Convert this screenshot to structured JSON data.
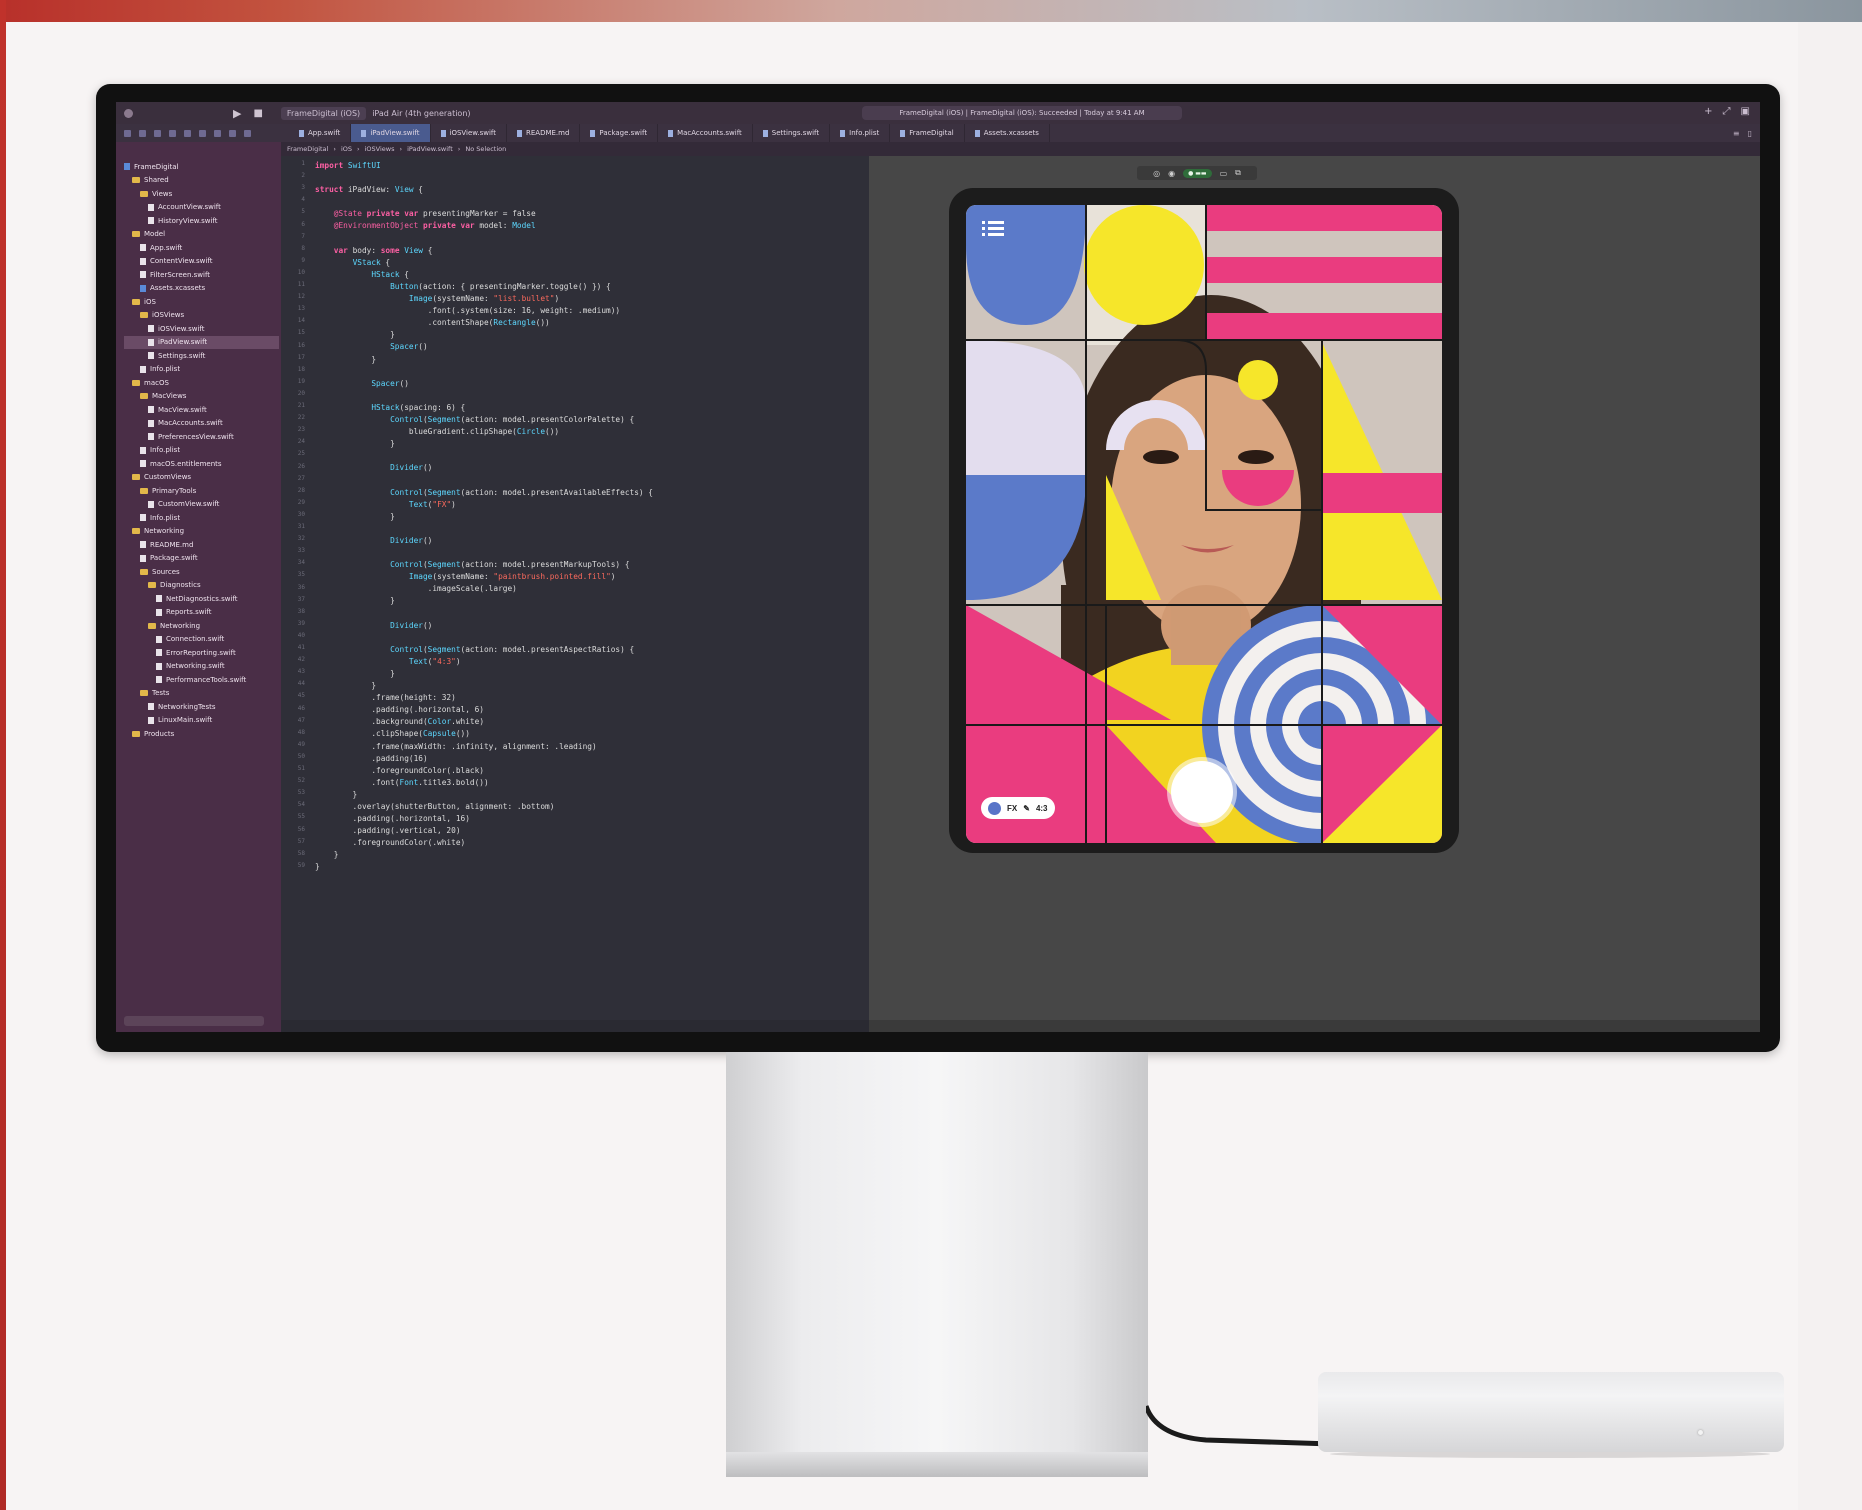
{
  "xcode": {
    "scheme": [
      "FrameDigital (iOS)",
      "iPad Air (4th generation)"
    ],
    "status": "FrameDigital (iOS) | FrameDigital (iOS): Succeeded | Today at 9:41 AM",
    "tabs": [
      "App.swift",
      "iPadView.swift",
      "iOSView.swift",
      "README.md",
      "Package.swift",
      "MacAccounts.swift",
      "Settings.swift",
      "Info.plist",
      "FrameDigital",
      "Assets.xcassets"
    ],
    "active_tab_index": 1,
    "jump_path": [
      "FrameDigital",
      "iOS",
      "iOSViews",
      "iPadView.swift",
      "No Selection"
    ],
    "navigator": [
      {
        "label": "FrameDigital",
        "kind": "proj",
        "indent": 0
      },
      {
        "label": "Shared",
        "kind": "folder",
        "indent": 1
      },
      {
        "label": "Views",
        "kind": "folder",
        "indent": 2
      },
      {
        "label": "AccountView.swift",
        "kind": "file",
        "indent": 3
      },
      {
        "label": "HistoryView.swift",
        "kind": "file",
        "indent": 3
      },
      {
        "label": "Model",
        "kind": "folder",
        "indent": 1
      },
      {
        "label": "App.swift",
        "kind": "file",
        "indent": 2
      },
      {
        "label": "ContentView.swift",
        "kind": "file",
        "indent": 2
      },
      {
        "label": "FilterScreen.swift",
        "kind": "file",
        "indent": 2
      },
      {
        "label": "Assets.xcassets",
        "kind": "proj",
        "indent": 2
      },
      {
        "label": "iOS",
        "kind": "folder",
        "indent": 1
      },
      {
        "label": "iOSViews",
        "kind": "folder",
        "indent": 2
      },
      {
        "label": "iOSView.swift",
        "kind": "file",
        "indent": 3
      },
      {
        "label": "iPadView.swift",
        "kind": "file",
        "indent": 3,
        "selected": true
      },
      {
        "label": "Settings.swift",
        "kind": "file",
        "indent": 3
      },
      {
        "label": "Info.plist",
        "kind": "file",
        "indent": 2
      },
      {
        "label": "macOS",
        "kind": "folder",
        "indent": 1
      },
      {
        "label": "MacViews",
        "kind": "folder",
        "indent": 2
      },
      {
        "label": "MacView.swift",
        "kind": "file",
        "indent": 3
      },
      {
        "label": "MacAccounts.swift",
        "kind": "file",
        "indent": 3
      },
      {
        "label": "PreferencesView.swift",
        "kind": "file",
        "indent": 3
      },
      {
        "label": "Info.plist",
        "kind": "file",
        "indent": 2
      },
      {
        "label": "macOS.entitlements",
        "kind": "file",
        "indent": 2
      },
      {
        "label": "CustomViews",
        "kind": "folder",
        "indent": 1
      },
      {
        "label": "PrimaryTools",
        "kind": "folder",
        "indent": 2
      },
      {
        "label": "CustomView.swift",
        "kind": "file",
        "indent": 3
      },
      {
        "label": "Info.plist",
        "kind": "file",
        "indent": 2
      },
      {
        "label": "Networking",
        "kind": "folder",
        "indent": 1
      },
      {
        "label": "README.md",
        "kind": "file",
        "indent": 2
      },
      {
        "label": "Package.swift",
        "kind": "file",
        "indent": 2
      },
      {
        "label": "Sources",
        "kind": "folder",
        "indent": 2
      },
      {
        "label": "Diagnostics",
        "kind": "folder",
        "indent": 3
      },
      {
        "label": "NetDiagnostics.swift",
        "kind": "file",
        "indent": 4
      },
      {
        "label": "Reports.swift",
        "kind": "file",
        "indent": 4
      },
      {
        "label": "Networking",
        "kind": "folder",
        "indent": 3
      },
      {
        "label": "Connection.swift",
        "kind": "file",
        "indent": 4
      },
      {
        "label": "ErrorReporting.swift",
        "kind": "file",
        "indent": 4
      },
      {
        "label": "Networking.swift",
        "kind": "file",
        "indent": 4
      },
      {
        "label": "PerformanceTools.swift",
        "kind": "file",
        "indent": 4
      },
      {
        "label": "Tests",
        "kind": "folder",
        "indent": 2
      },
      {
        "label": "NetworkingTests",
        "kind": "file",
        "indent": 3
      },
      {
        "label": "LinuxMain.swift",
        "kind": "file",
        "indent": 3
      },
      {
        "label": "Products",
        "kind": "folder",
        "indent": 1
      }
    ],
    "code_lines": [
      "import SwiftUI",
      "",
      "struct iPadView: View {",
      "",
      "    @State private var presentingMarker = false",
      "    @EnvironmentObject private var model: Model",
      "",
      "    var body: some View {",
      "        VStack {",
      "            HStack {",
      "                Button(action: { presentingMarker.toggle() }) {",
      "                    Image(systemName: \"list.bullet\")",
      "                        .font(.system(size: 16, weight: .medium))",
      "                        .contentShape(Rectangle())",
      "                }",
      "                Spacer()",
      "            }",
      "",
      "            Spacer()",
      "",
      "            HStack(spacing: 6) {",
      "                Control(Segment(action: model.presentColorPalette) {",
      "                    blueGradient.clipShape(Circle())",
      "                }",
      "",
      "                Divider()",
      "",
      "                Control(Segment(action: model.presentAvailableEffects) {",
      "                    Text(\"FX\")",
      "                }",
      "",
      "                Divider()",
      "",
      "                Control(Segment(action: model.presentMarkupTools) {",
      "                    Image(systemName: \"paintbrush.pointed.fill\")",
      "                        .imageScale(.large)",
      "                }",
      "",
      "                Divider()",
      "",
      "                Control(Segment(action: model.presentAspectRatios) {",
      "                    Text(\"4:3\")",
      "                }",
      "            }",
      "            .frame(height: 32)",
      "            .padding(.horizontal, 6)",
      "            .background(Color.white)",
      "            .clipShape(Capsule())",
      "            .frame(maxWidth: .infinity, alignment: .leading)",
      "            .padding(16)",
      "            .foregroundColor(.black)",
      "            .font(Font.title3.bold())",
      "        }",
      "        .overlay(shutterButton, alignment: .bottom)",
      "        .padding(.horizontal, 16)",
      "        .padding(.vertical, 20)",
      "        .foregroundColor(.white)",
      "    }",
      "}"
    ],
    "preview_controls": {
      "fx_label": "FX",
      "aspect_label": "4:3"
    },
    "colors": {
      "navigator_bg": "#4a2e47",
      "editor_bg": "#2f2f38",
      "keyword": "#fc5fa3",
      "type": "#5dd8ff",
      "string": "#fc6a5d",
      "accent_tab": "#4a5b8f",
      "canvas_bg": "#474747"
    }
  }
}
